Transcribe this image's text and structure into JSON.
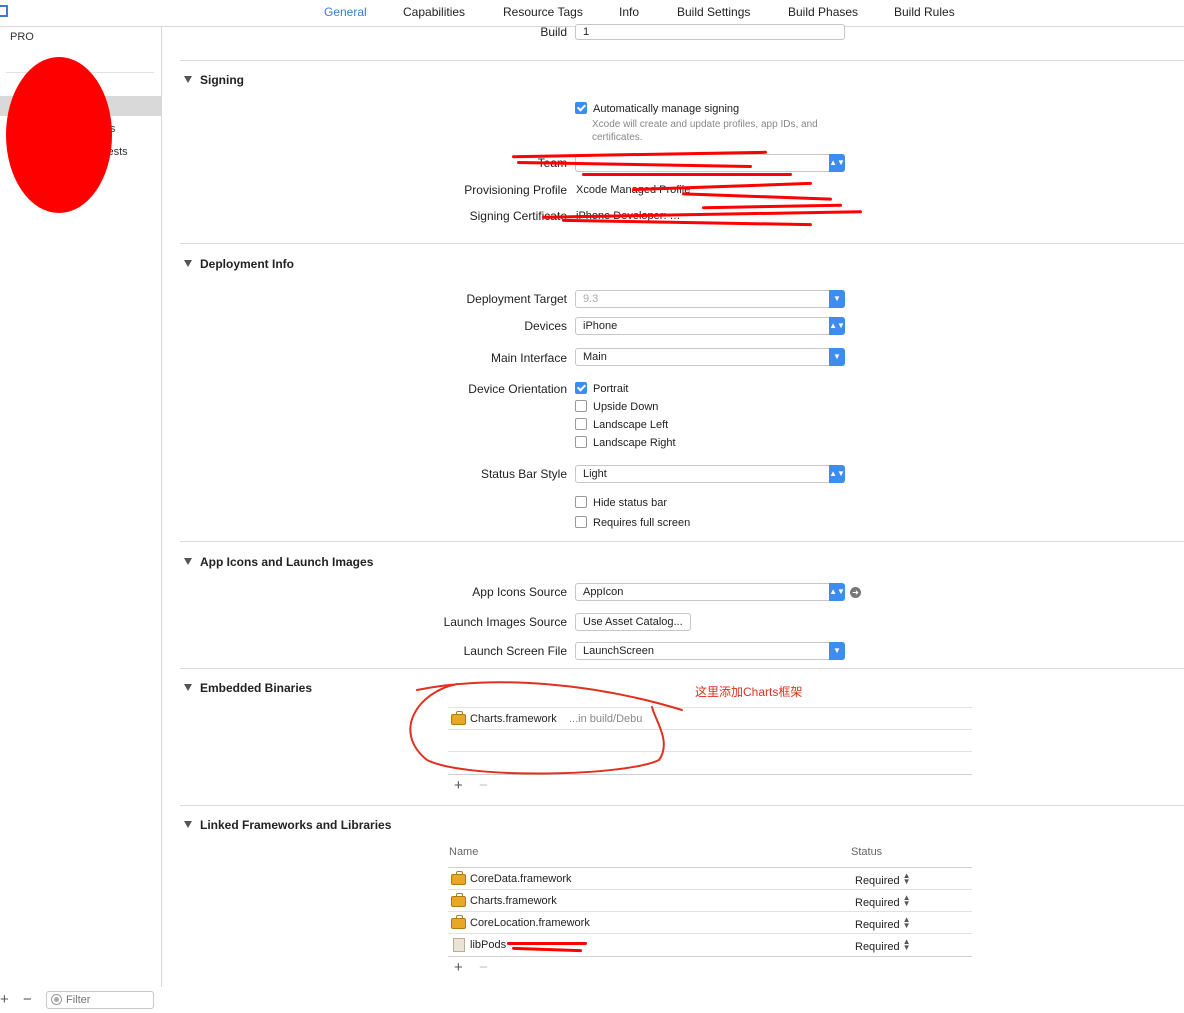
{
  "tabs": [
    {
      "label": "General",
      "active": true
    },
    {
      "label": "Capabilities"
    },
    {
      "label": "Resource Tags"
    },
    {
      "label": "Info"
    },
    {
      "label": "Build Settings"
    },
    {
      "label": "Build Phases"
    },
    {
      "label": "Build Rules"
    }
  ],
  "sidebar": {
    "header": "PRO",
    "items": [
      "s",
      "Tests"
    ],
    "add": "+",
    "remove": "−",
    "filter_placeholder": "Filter"
  },
  "identity": {
    "build_label": "Build",
    "build_value": "1"
  },
  "signing": {
    "title": "Signing",
    "auto_label": "Automatically manage signing",
    "auto_checked": true,
    "auto_hint": "Xcode will create and update profiles, app IDs, and certificates.",
    "team_label": "Team",
    "profile_label": "Provisioning Profile",
    "profile_value": "Xcode Managed Profile",
    "cert_label": "Signing Certificate",
    "cert_value": "iPhone Developer: …"
  },
  "deployment": {
    "title": "Deployment Info",
    "target_label": "Deployment Target",
    "target_value": "9.3",
    "devices_label": "Devices",
    "devices_value": "iPhone",
    "interface_label": "Main Interface",
    "interface_value": "Main",
    "orientation_label": "Device Orientation",
    "orientations": [
      {
        "label": "Portrait",
        "checked": true
      },
      {
        "label": "Upside Down",
        "checked": false
      },
      {
        "label": "Landscape Left",
        "checked": false
      },
      {
        "label": "Landscape Right",
        "checked": false
      }
    ],
    "statusbar_label": "Status Bar Style",
    "statusbar_value": "Light",
    "hide_status": "Hide status bar",
    "full_screen": "Requires full screen"
  },
  "app_icons": {
    "title": "App Icons and Launch Images",
    "icons_label": "App Icons Source",
    "icons_value": "AppIcon",
    "launch_images_label": "Launch Images Source",
    "launch_images_button": "Use Asset Catalog...",
    "launch_file_label": "Launch Screen File",
    "launch_file_value": "LaunchScreen"
  },
  "embedded": {
    "title": "Embedded Binaries",
    "annotation": "这里添加Charts框架",
    "items": [
      {
        "name": "Charts.framework",
        "path": "...in build/Debu"
      }
    ],
    "add": "+",
    "remove": "−"
  },
  "linked": {
    "title": "Linked Frameworks and Libraries",
    "col_name": "Name",
    "col_status": "Status",
    "items": [
      {
        "name": "CoreData.framework",
        "status": "Required",
        "icon": "framework-icon"
      },
      {
        "name": "Charts.framework",
        "status": "Required",
        "icon": "framework-icon"
      },
      {
        "name": "CoreLocation.framework",
        "status": "Required",
        "icon": "framework-icon"
      },
      {
        "name": "libPods",
        "status": "Required",
        "icon": "library-icon"
      }
    ],
    "add": "+",
    "remove": "−"
  },
  "colors": {
    "accent": "#3b7bd6",
    "redaction": "#ff0000",
    "annotation": "#e0301e"
  }
}
